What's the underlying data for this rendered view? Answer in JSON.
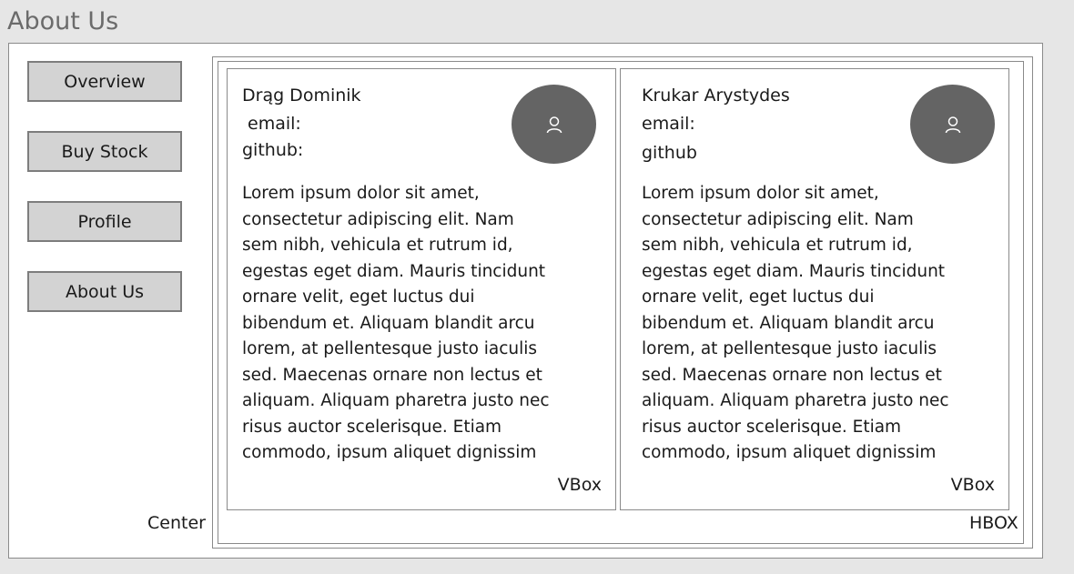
{
  "page": {
    "title": "About Us"
  },
  "nav": {
    "items": [
      {
        "label": "Overview"
      },
      {
        "label": "Buy Stock"
      },
      {
        "label": "Profile"
      },
      {
        "label": "About Us"
      }
    ]
  },
  "layout_labels": {
    "center": "Center",
    "hbox": "HBOX",
    "vbox": "VBox"
  },
  "people": [
    {
      "name": "Drąg Dominik",
      "email_label": "email:",
      "github_label": "github:",
      "avatar_icon": "user-icon",
      "bio": "Lorem ipsum dolor sit amet, consectetur adipiscing elit. Nam sem nibh, vehicula et rutrum id, egestas eget diam. Mauris tincidunt ornare velit, eget luctus dui bibendum et. Aliquam blandit arcu lorem, at pellentesque justo iaculis sed. Maecenas ornare non lectus et aliquam. Aliquam pharetra justo nec risus auctor scelerisque. Etiam commodo, ipsum aliquet dignissim"
    },
    {
      "name": "Krukar Arystydes",
      "email_label": "email:",
      "github_label": "github",
      "avatar_icon": "user-icon",
      "bio": "Lorem ipsum dolor sit amet, consectetur adipiscing elit. Nam sem nibh, vehicula et rutrum id, egestas eget diam. Mauris tincidunt ornare velit, eget luctus dui bibendum et. Aliquam blandit arcu lorem, at pellentesque justo iaculis sed. Maecenas ornare non lectus et aliquam. Aliquam pharetra justo nec risus auctor scelerisque. Etiam commodo, ipsum aliquet dignissim"
    }
  ],
  "colors": {
    "background": "#e6e6e6",
    "panel": "#ffffff",
    "border": "#8a8a8a",
    "button": "#d3d3d3",
    "avatar": "#646464",
    "title": "#6b6b6b"
  }
}
